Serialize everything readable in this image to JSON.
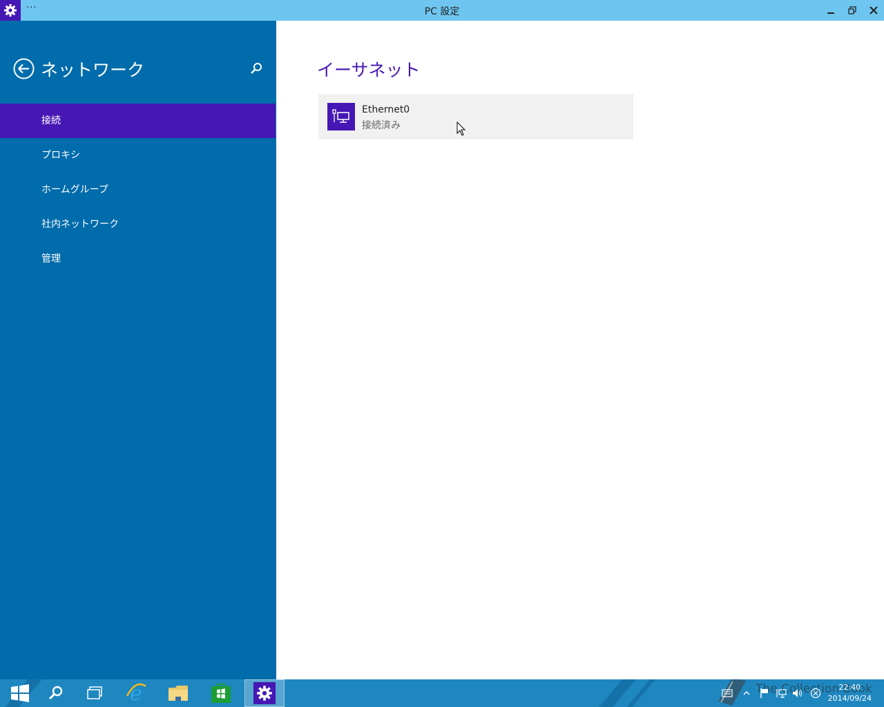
{
  "window": {
    "title": "PC 設定",
    "menu_glyph": "···",
    "app_icon": "gear-icon",
    "accent": "#4617b4",
    "titlebar_color": "#6ec6f0"
  },
  "sidebar": {
    "title": "ネットワーク",
    "back_icon": "back-arrow-icon",
    "search_icon": "search-icon",
    "background": "#006cab",
    "items": [
      {
        "label": "接続",
        "active": true
      },
      {
        "label": "プロキシ",
        "active": false
      },
      {
        "label": "ホームグループ",
        "active": false
      },
      {
        "label": "社内ネットワーク",
        "active": false
      },
      {
        "label": "管理",
        "active": false
      }
    ]
  },
  "main": {
    "section_title": "イーサネット",
    "network": {
      "name": "Ethernet0",
      "status": "接続済み",
      "icon": "ethernet-icon"
    }
  },
  "taskbar": {
    "apps": [
      {
        "name": "start-button",
        "icon": "windows-logo-icon"
      },
      {
        "name": "search-button",
        "icon": "search-icon"
      },
      {
        "name": "task-view-button",
        "icon": "task-view-icon"
      },
      {
        "name": "internet-explorer-button",
        "icon": "ie-icon"
      },
      {
        "name": "file-explorer-button",
        "icon": "folder-icon"
      },
      {
        "name": "store-button",
        "icon": "store-icon"
      },
      {
        "name": "pc-settings-button",
        "icon": "gear-icon",
        "active": true
      }
    ],
    "tray": [
      "keyboard-icon",
      "show-hidden-icons",
      "flag-icon",
      "network-icon",
      "volume-icon",
      "ime-icon"
    ],
    "watermark": "The Collection Book",
    "time": "22:40",
    "date": "2014/09/24"
  }
}
